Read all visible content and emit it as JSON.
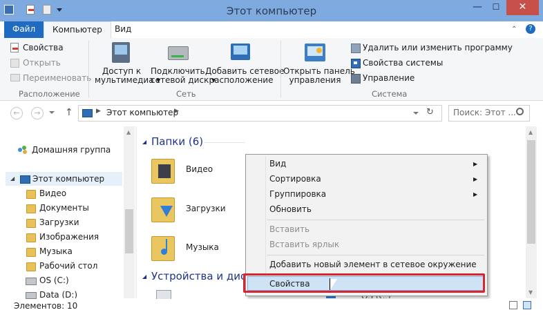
{
  "window": {
    "title": "Этот компьютер",
    "min_glyph": "—",
    "max_glyph": "☐",
    "close_glyph": "✕"
  },
  "ribbon_tabs": {
    "file": "Файл",
    "computer": "Компьютер",
    "view": "Вид"
  },
  "ribbon": {
    "location": {
      "properties": "Свойства",
      "open": "Открыть",
      "rename": "Переименовать",
      "label": "Расположение"
    },
    "network": {
      "media_access": "Доступ к\nмультимедиа ▾",
      "map_drive": "Подключить\nсетевой диск ▾",
      "add_location": "Добавить сетевое\nрасположение",
      "label": "Сеть"
    },
    "system": {
      "control_panel": "Открыть панель\nуправления",
      "uninstall": "Удалить или изменить программу",
      "sys_props": "Свойства системы",
      "manage": "Управление",
      "label": "Система"
    }
  },
  "address": {
    "path": "Этот компьютер",
    "search_placeholder": "Поиск: Этот ..."
  },
  "nav": {
    "homegroup": "Домашняя группа",
    "this_pc": "Этот компьютер",
    "items": [
      "Видео",
      "Документы",
      "Загрузки",
      "Изображения",
      "Музыка",
      "Рабочий стол",
      "OS (C:)",
      "Data (D:)"
    ]
  },
  "content": {
    "folders_header": "Папки (6)",
    "folders": [
      "Видео",
      "Загрузки",
      "Музыка"
    ],
    "devices_header": "Устройства и диски",
    "partial_drive": "OS (C:)"
  },
  "context_menu": {
    "view": "Вид",
    "sort": "Сортировка",
    "group": "Группировка",
    "refresh": "Обновить",
    "paste": "Вставить",
    "paste_shortcut": "Вставить ярлык",
    "add_network": "Добавить новый элемент в сетевое окружение",
    "properties": "Свойства",
    "submenu_arrow": "▶"
  },
  "status": {
    "items": "Элементов: 10"
  },
  "colors": {
    "titlebar": "#7eaadf",
    "file_tab": "#1f6bc2",
    "close": "#c7504a",
    "highlight_box": "#d5272f",
    "header_text": "#1e3287"
  }
}
